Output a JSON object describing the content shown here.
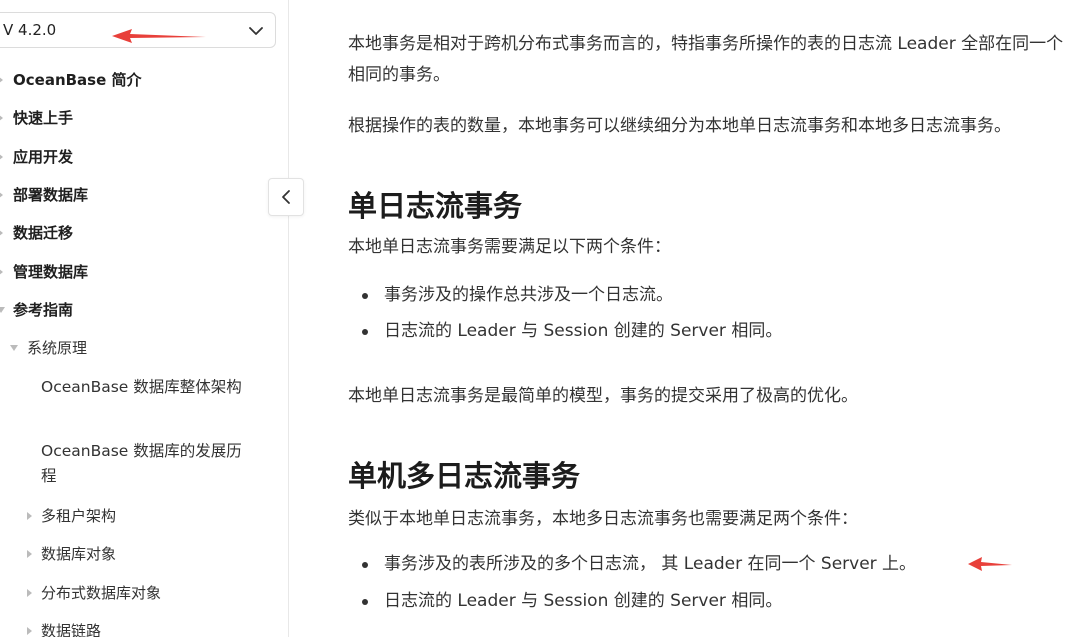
{
  "sidebar": {
    "version_label": "V 4.2.0",
    "top_items": [
      {
        "label": "OceanBase 简介"
      },
      {
        "label": "快速上手"
      },
      {
        "label": "应用开发"
      },
      {
        "label": "部署数据库"
      },
      {
        "label": "数据迁移"
      },
      {
        "label": "管理数据库"
      },
      {
        "label": "参考指南"
      }
    ],
    "sub_items": [
      {
        "label": "系统原理"
      }
    ],
    "leaf_items": [
      {
        "label": "OceanBase 数据库整体架构"
      },
      {
        "label": "OceanBase 数据库的发展历程"
      }
    ],
    "third_items": [
      {
        "label": "多租户架构"
      },
      {
        "label": "数据库对象"
      },
      {
        "label": "分布式数据库对象"
      },
      {
        "label": "数据链路"
      }
    ]
  },
  "content": {
    "intro_line1": "本地事务是相对于跨机分布式事务而言的，特指事务所操作的表的日志流 Leader 全部在同一个",
    "intro_line2": "相同的事务。",
    "intro_para2": "根据操作的表的数量，本地事务可以继续细分为本地单日志流事务和本地多日志流事务。",
    "section1": {
      "heading": "单日志流事务",
      "lead": "本地单日志流事务需要满足以下两个条件：",
      "bullets": [
        "事务涉及的操作总共涉及一个日志流。",
        "日志流的 Leader 与 Session 创建的 Server 相同。"
      ],
      "tail": "本地单日志流事务是最简单的模型，事务的提交采用了极高的优化。"
    },
    "section2": {
      "heading": "单机多日志流事务",
      "lead": "类似于本地单日志流事务，本地多日志流事务也需要满足两个条件：",
      "bullets": [
        "事务涉及的表所涉及的多个日志流， 其 Leader 在同一个 Server 上。",
        "日志流的 Leader 与 Session 创建的 Server 相同。"
      ]
    }
  },
  "colors": {
    "annotation_arrow": "#e8403a",
    "border": "#e8e8e8",
    "text": "#333333"
  }
}
